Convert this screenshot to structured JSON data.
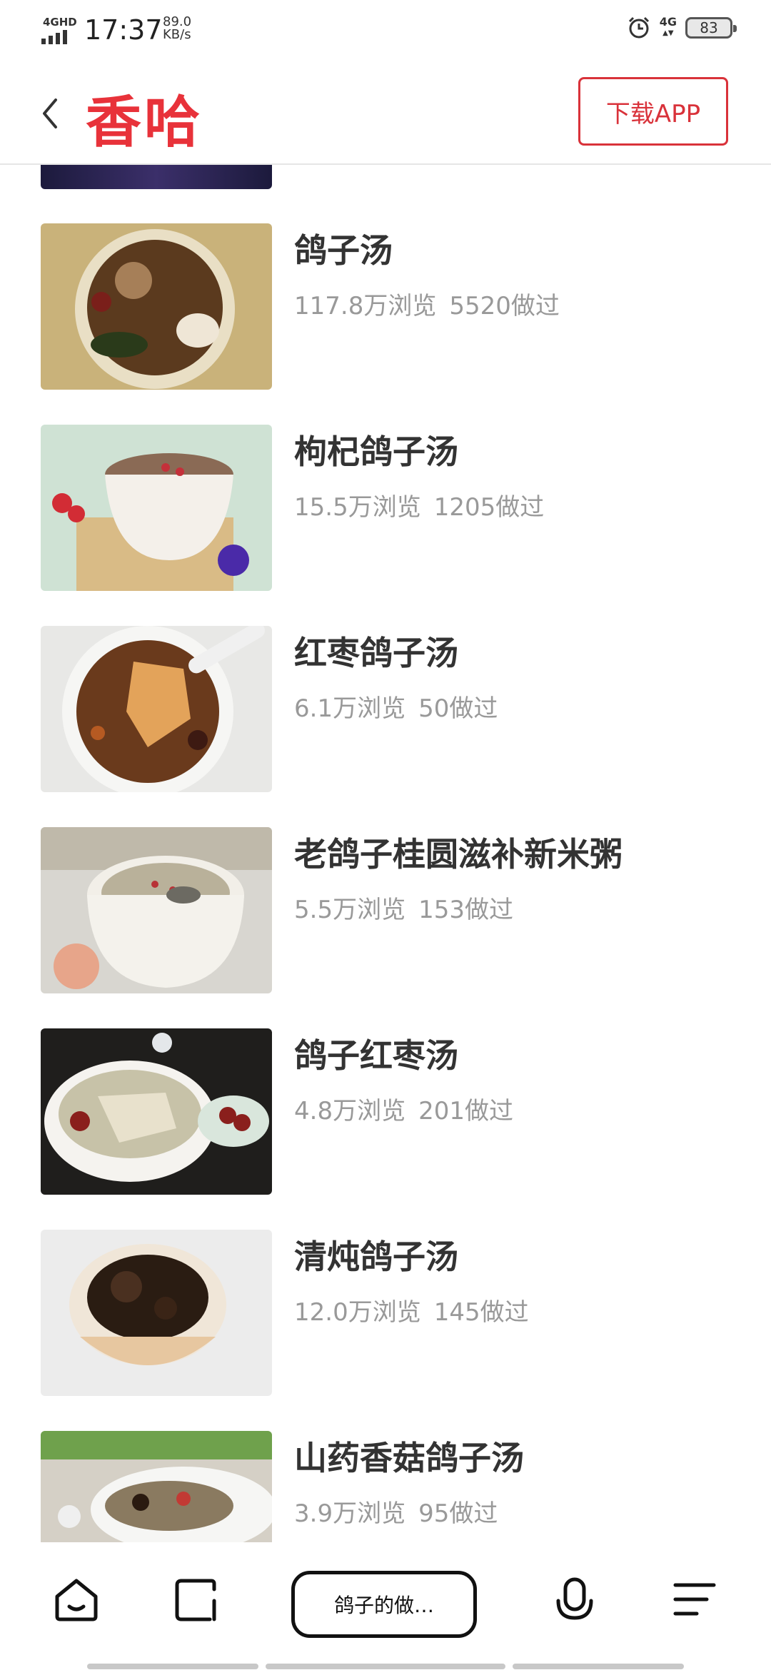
{
  "status": {
    "network": "4GHD",
    "time": "17:37",
    "speed_value": "89.0",
    "speed_unit": "KB/s",
    "right_network": "4G",
    "battery": "83"
  },
  "header": {
    "logo": "香哈",
    "download_label": "下载APP"
  },
  "recipes": [
    {
      "title": "鸽子汤",
      "views": "117.8万浏览",
      "made": "5520做过"
    },
    {
      "title": "枸杞鸽子汤",
      "views": "15.5万浏览",
      "made": "1205做过"
    },
    {
      "title": "红枣鸽子汤",
      "views": "6.1万浏览",
      "made": "50做过"
    },
    {
      "title": "老鸽子桂圆滋补新米粥",
      "views": "5.5万浏览",
      "made": "153做过"
    },
    {
      "title": "鸽子红枣汤",
      "views": "4.8万浏览",
      "made": "201做过"
    },
    {
      "title": "清炖鸽子汤",
      "views": "12.0万浏览",
      "made": "145做过"
    },
    {
      "title": "山药香菇鸽子汤",
      "views": "3.9万浏览",
      "made": "95做过"
    }
  ],
  "bottom_nav": {
    "search_label": "鸽子的做…"
  },
  "colors": {
    "brand": "#e8323a",
    "title": "#333333",
    "meta": "#999999"
  }
}
